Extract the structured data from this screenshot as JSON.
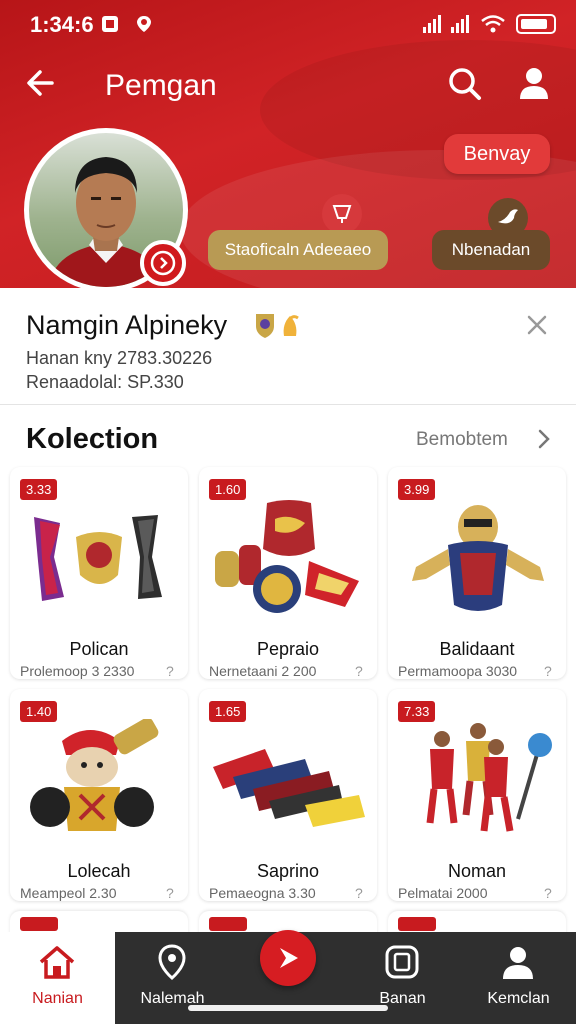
{
  "status": {
    "time": "1:34:6"
  },
  "topbar": {
    "title": "Pemgan"
  },
  "header": {
    "pill_red": "Benvay",
    "pill_tan": "Staoficaln Adeeaeo",
    "pill_brown": "Nbenadan"
  },
  "profile": {
    "name": "Namgin Alpineky",
    "line1": "Hanan kny  2783.30226",
    "line2": "Renaadolal: SP.330"
  },
  "collection": {
    "title": "Kolection",
    "see_all": "Bemobtem",
    "items": [
      {
        "price": "3.33",
        "name": "Polican",
        "sub": "Prolemoop 3 2330",
        "help": "?"
      },
      {
        "price": "1.60",
        "name": "Pepraio",
        "sub": "Nernetaani 2 200",
        "help": "?"
      },
      {
        "price": "3.99",
        "name": "Balidaant",
        "sub": "Permamoopa 3030",
        "help": "?"
      },
      {
        "price": "1.40",
        "name": "Lolecah",
        "sub": "Meampeol 2.30",
        "help": "?"
      },
      {
        "price": "1.65",
        "name": "Saprino",
        "sub": "Pemaeogna 3.30",
        "help": "?"
      },
      {
        "price": "7.33",
        "name": "Noman",
        "sub": "Pelmatai 2000",
        "help": "?"
      }
    ]
  },
  "nav": {
    "items": [
      {
        "label": "Nanian"
      },
      {
        "label": "Nalemah"
      },
      {
        "label": "Banan"
      },
      {
        "label": "Kemclan"
      }
    ]
  },
  "colors": {
    "brand_red": "#c81b1f",
    "nav_bg": "#2f2f2f",
    "tan": "#b89a54",
    "brown": "#6b4a2a"
  }
}
